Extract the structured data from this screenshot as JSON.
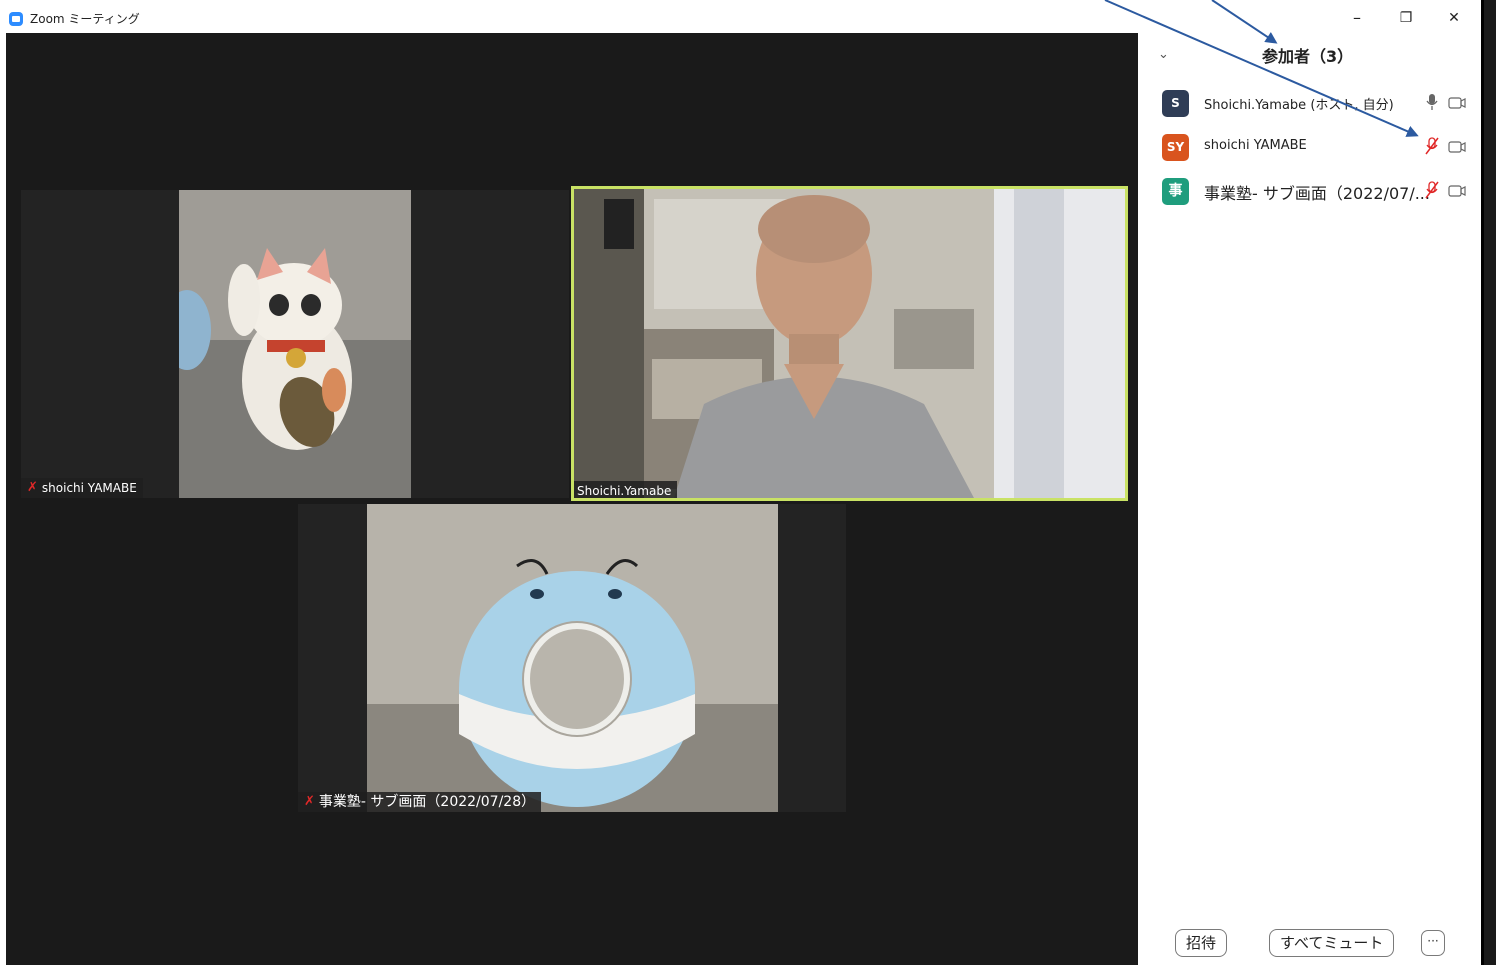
{
  "window": {
    "title": "Zoom ミーティング",
    "minimize": "–",
    "restore": "❐",
    "close": "✕"
  },
  "tiles": [
    {
      "name": "shoichi YAMABE",
      "muted": true
    },
    {
      "name": "Shoichi.Yamabe",
      "muted": false,
      "active_speaker": true
    },
    {
      "name": "事業塾- サブ画面（2022/07/28）",
      "muted": true
    }
  ],
  "panel": {
    "title": "参加者（3）",
    "collapse_icon": "chevron-down-icon",
    "participants": [
      {
        "initials": "S",
        "avatar_color": "#2f3d56",
        "name": "Shoichi.Yamabe (ホスト, 自分)",
        "mic": "mic-on",
        "video": "off"
      },
      {
        "initials": "SY",
        "avatar_color": "#d9541e",
        "name": "shoichi YAMABE",
        "mic": "mic-muted",
        "video": "off"
      },
      {
        "initials": "事",
        "avatar_color": "#1f9d7d",
        "name": "事業塾- サブ画面（2022/07/...",
        "mic": "mic-muted",
        "video": "off"
      }
    ],
    "buttons": {
      "invite": "招待",
      "mute_all": "すべてミュート",
      "more": "···"
    }
  },
  "colors": {
    "stage_bg": "#1a1a1a",
    "active_speaker_border": "#c9e265",
    "mute_red": "#e02828",
    "annotation_arrow": "#2c5aa0"
  }
}
